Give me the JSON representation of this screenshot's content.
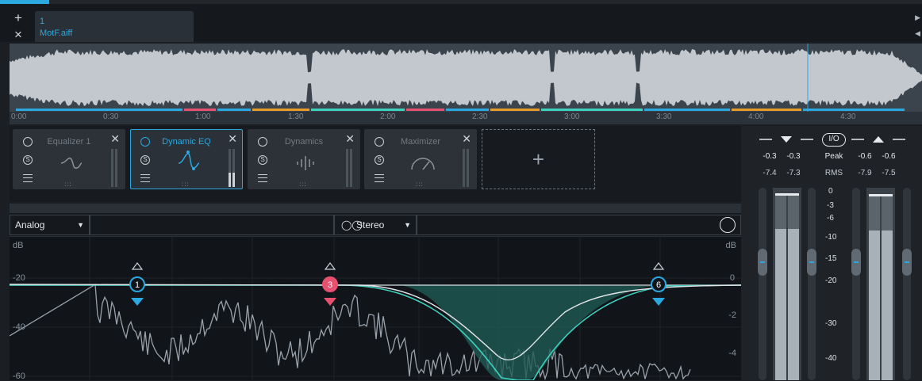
{
  "tabs": {
    "add_label": "+",
    "close_label": "×",
    "file": {
      "number": "1",
      "name": "MotF.aiff"
    },
    "arrow_right": "▶",
    "arrow_left": "◀"
  },
  "timeline": {
    "ticks": [
      "0:00",
      "0:30",
      "1:00",
      "1:30",
      "2:00",
      "2:30",
      "3:00",
      "3:30",
      "4:00",
      "4:30"
    ]
  },
  "modules": [
    {
      "title": "Equalizer 1",
      "icon": "equalizer-curve-icon",
      "active": false
    },
    {
      "title": "Dynamic EQ",
      "icon": "dynamic-eq-curve-icon",
      "active": true
    },
    {
      "title": "Dynamics",
      "icon": "dynamics-bars-icon",
      "active": false
    },
    {
      "title": "Maximizer",
      "icon": "maximizer-gauge-icon",
      "active": false
    }
  ],
  "add_module_label": "+",
  "eq": {
    "mode": "Analog",
    "stereo_mode": "Stereo",
    "left_unit": "dB",
    "right_unit": "dB",
    "left_scale": [
      "-20",
      "-40",
      "-60"
    ],
    "right_scale": [
      "0",
      "-2",
      "-4"
    ],
    "nodes": [
      {
        "label": "1",
        "color": "#2aa8df"
      },
      {
        "label": "3",
        "color": "#e8506f"
      },
      {
        "label": "6",
        "color": "#2aa8df"
      }
    ],
    "colors": {
      "accent": "#2aa8df",
      "curve": "#3fd1c0",
      "node3": "#e8506f"
    }
  },
  "io": {
    "io_label": "I/O",
    "peak_label": "Peak",
    "rms_label": "RMS",
    "input": {
      "peak": [
        "-0.3",
        "-0.3"
      ],
      "rms": [
        "-7.4",
        "-7.3"
      ]
    },
    "output": {
      "peak": [
        "-0.6",
        "-0.6"
      ],
      "rms": [
        "-7.9",
        "-7.5"
      ]
    },
    "scale": [
      "0",
      "-3",
      "-6",
      "-10",
      "-15",
      "-20",
      "-30",
      "-40"
    ]
  }
}
